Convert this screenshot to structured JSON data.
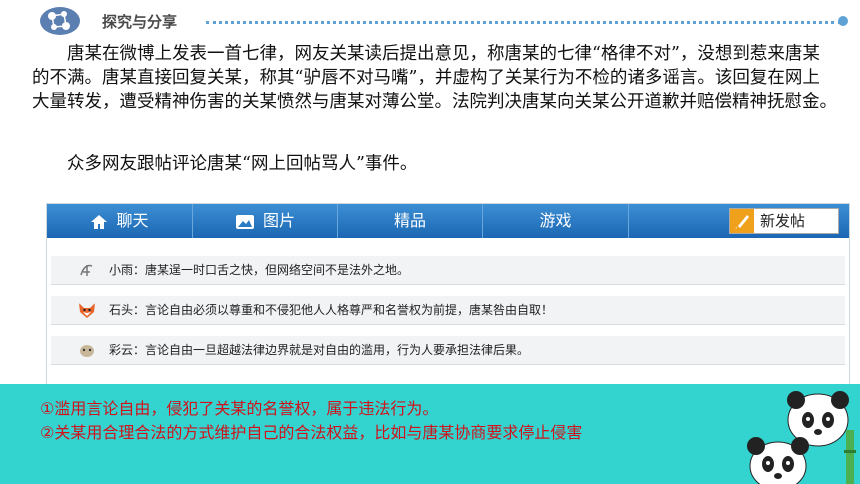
{
  "section": {
    "title": "探究与分享"
  },
  "story": {
    "paragraph1": "唐某在微博上发表一首七律，网友关某读后提出意见，称唐某的七律“格律不对”，没想到惹来唐某的不满。唐某直接回复关某，称其“驴唇不对马嘴”，并虚构了关某行为不检的诸多谣言。该回复在网上大量转发，遭受精神伤害的关某愤然与唐某对薄公堂。法院判决唐某向关某公开道歉并赔偿精神抚慰金。",
    "paragraph2": "众多网友跟帖评论唐某“网上回帖骂人”事件。"
  },
  "forum": {
    "nav": [
      {
        "label": "聊天",
        "icon": "home-icon"
      },
      {
        "label": "图片",
        "icon": "image-icon"
      },
      {
        "label": "精品"
      },
      {
        "label": "游戏"
      }
    ],
    "new_post": {
      "label": "新发帖",
      "icon": "pen-icon"
    },
    "posts": [
      {
        "text": "小雨：唐某逞一时口舌之快，但网络空间不是法外之地。",
        "avatar": "sketch-avatar-icon"
      },
      {
        "text": "石头：言论自由必须以尊重和不侵犯他人人格尊严和名誉权为前提，唐某咎由自取！",
        "avatar": "fox-avatar-icon"
      },
      {
        "text": "彩云：言论自由一旦超越法律边界就是对自由的滥用，行为人要承担法律后果。",
        "avatar": "sketch-avatar-icon"
      }
    ]
  },
  "answers": {
    "a1": "①滥用言论自由，侵犯了关某的名誉权，属于违法行为。",
    "a2": "②关某用合理合法的方式维护自己的合法权益，比如与唐某协商要求停止侵害"
  },
  "colors": {
    "nav": "#1b66b3",
    "answer_bg": "#33d4cf",
    "answer_text": "#d1121b",
    "accent_dots": "#5fa3d6"
  }
}
